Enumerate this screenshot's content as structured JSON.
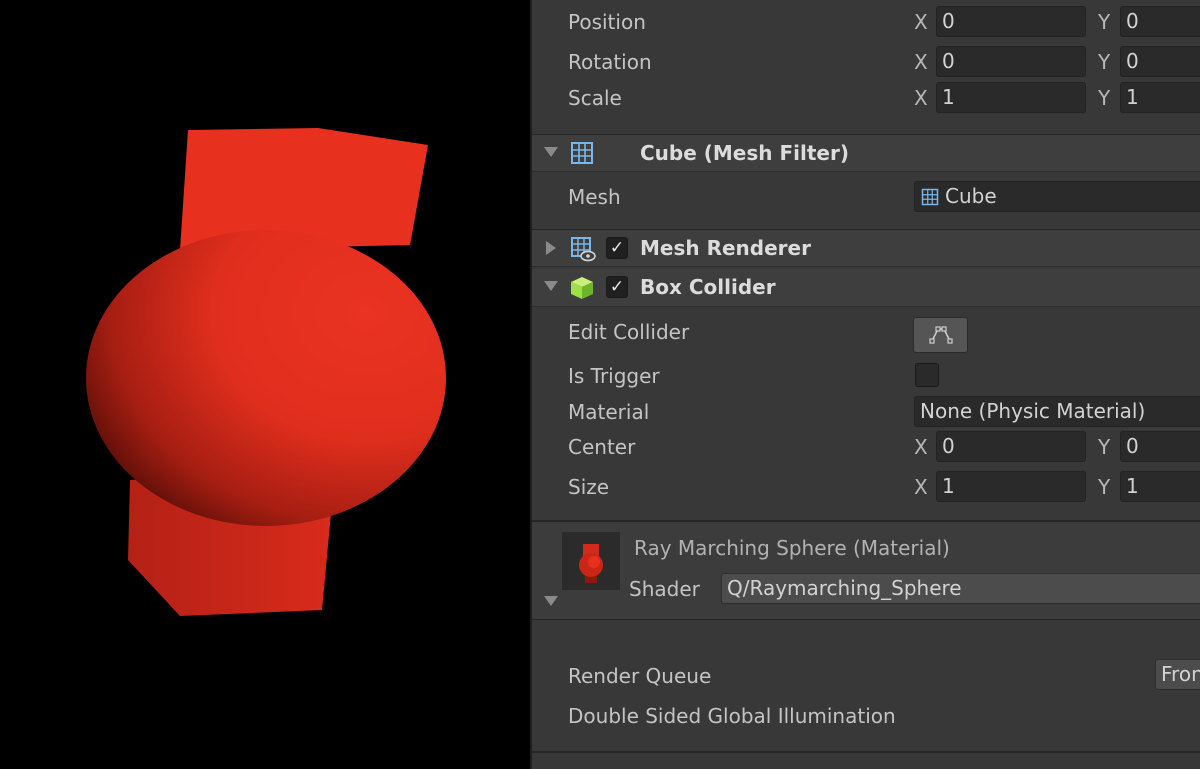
{
  "transform": {
    "position_label": "Position",
    "rotation_label": "Rotation",
    "scale_label": "Scale",
    "x_axis": "X",
    "y_axis": "Y",
    "position": {
      "x": "0",
      "y": "0"
    },
    "rotation": {
      "x": "0",
      "y": "0"
    },
    "scale": {
      "x": "1",
      "y": "1"
    }
  },
  "mesh_filter": {
    "title": "Cube (Mesh Filter)",
    "mesh_label": "Mesh",
    "mesh_value": "Cube"
  },
  "mesh_renderer": {
    "title": "Mesh Renderer",
    "check": "✓"
  },
  "box_collider": {
    "title": "Box Collider",
    "check": "✓",
    "edit_collider_label": "Edit Collider",
    "is_trigger_label": "Is Trigger",
    "material_label": "Material",
    "material_value": "None (Physic Material)",
    "center_label": "Center",
    "size_label": "Size",
    "center": {
      "x": "0",
      "y": "0"
    },
    "size": {
      "x": "1",
      "y": "1"
    }
  },
  "material": {
    "title": "Ray Marching Sphere (Material)",
    "shader_label": "Shader",
    "shader_value": "Q/Raymarching_Sphere",
    "render_queue_label": "Render Queue",
    "render_queue_value": "Fron",
    "double_sided_gi_label": "Double Sided Global Illumination"
  },
  "colors": {
    "object_red": "#e8301f",
    "panel_bg": "#383838",
    "viewport_bg": "#000000",
    "collider_icon_green": "#9ee04a",
    "mesh_icon_blue": "#7cb6e8"
  }
}
